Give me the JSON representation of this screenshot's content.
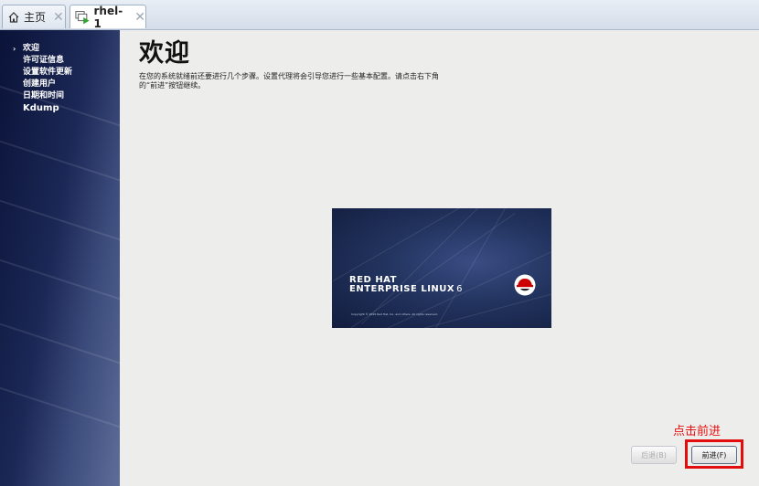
{
  "tabs": [
    {
      "label": "主页",
      "icon": "home-icon",
      "close": "✕"
    },
    {
      "label": "rhel-1",
      "icon": "vm-play-icon",
      "close": "✕"
    }
  ],
  "sidebar": {
    "items": [
      {
        "label": "欢迎",
        "current": true,
        "marker": "›"
      },
      {
        "label": "许可证信息"
      },
      {
        "label": "设置软件更新"
      },
      {
        "label": "创建用户"
      },
      {
        "label": "日期和时间"
      },
      {
        "label": "Kdump"
      }
    ]
  },
  "main": {
    "title": "欢迎",
    "description": "在您的系统就绪前还要进行几个步骤。设置代理将会引导您进行一些基本配置。请点击右下角的“前进”按钮继续。"
  },
  "splash": {
    "brand_line1": "RED HAT",
    "brand_line2": "ENTERPRISE LINUX",
    "version": "6",
    "copyright": "Copyright © 2010 Red Hat, Inc. and others. All rights reserved."
  },
  "annotation": {
    "text": "点击前进",
    "color": "#e81010"
  },
  "buttons": {
    "back": "后退(B)",
    "next": "前进(F)"
  },
  "colors": {
    "highlight": "#e30d0d",
    "sidebar": "#1b2755",
    "redhat": "#cc0000"
  }
}
